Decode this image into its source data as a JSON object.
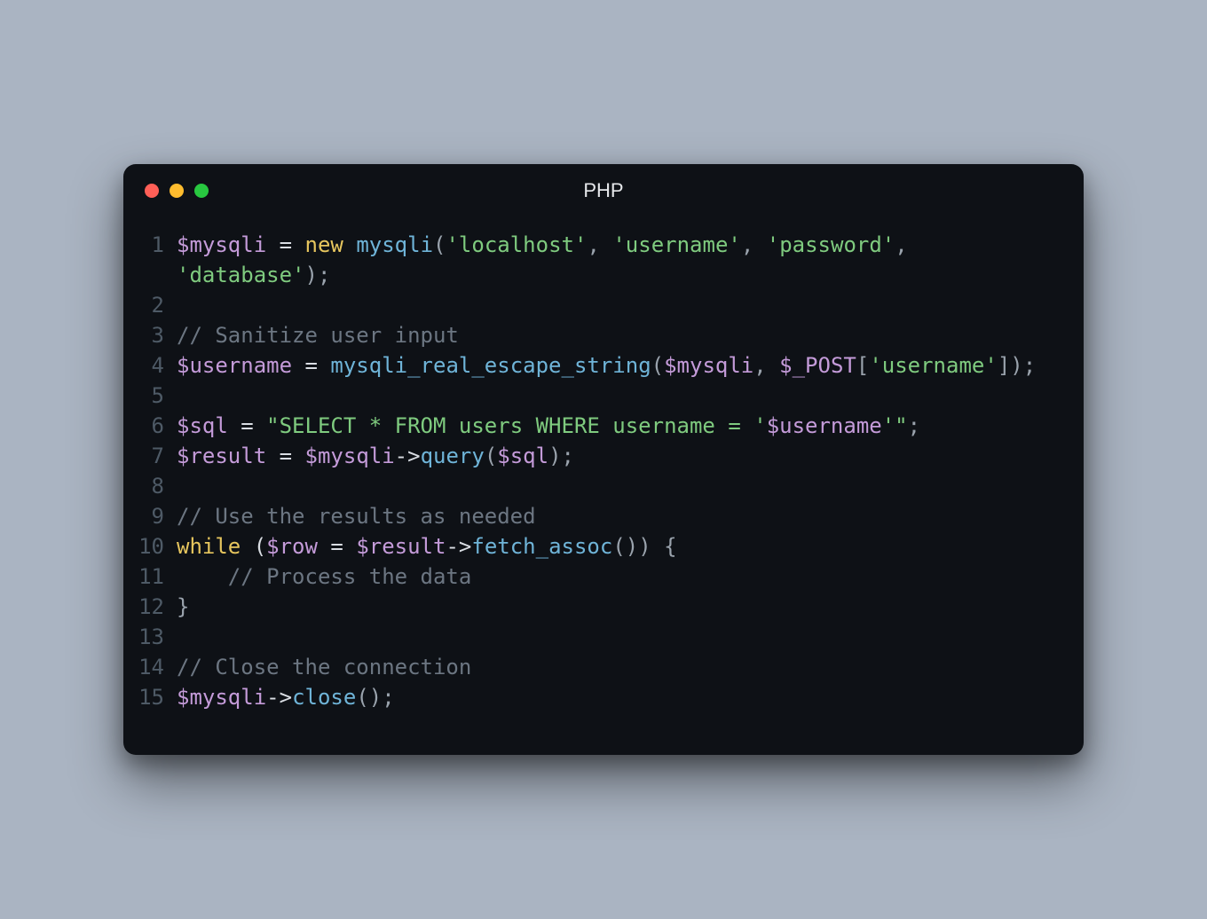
{
  "window": {
    "title": "PHP"
  },
  "colors": {
    "traffic_red": "#ff5f57",
    "traffic_yellow": "#febc2e",
    "traffic_green": "#28c840",
    "bg": "#0e1116",
    "page_bg": "#aab4c2"
  },
  "code": {
    "line_numbers": [
      "1",
      "2",
      "3",
      "4",
      "5",
      "6",
      "7",
      "8",
      "9",
      "10",
      "11",
      "12",
      "13",
      "14",
      "15"
    ],
    "lines": [
      {
        "n": "1",
        "tokens": [
          {
            "c": "tok-var",
            "t": "$mysqli"
          },
          {
            "c": "tok-op",
            "t": " = "
          },
          {
            "c": "tok-kw",
            "t": "new"
          },
          {
            "c": "tok-op",
            "t": " "
          },
          {
            "c": "tok-fn",
            "t": "mysqli"
          },
          {
            "c": "tok-punc",
            "t": "("
          },
          {
            "c": "tok-str",
            "t": "'localhost'"
          },
          {
            "c": "tok-punc",
            "t": ", "
          },
          {
            "c": "tok-str",
            "t": "'username'"
          },
          {
            "c": "tok-punc",
            "t": ", "
          },
          {
            "c": "tok-str",
            "t": "'password'"
          },
          {
            "c": "tok-punc",
            "t": ", "
          },
          {
            "c": "tok-str",
            "t": "'database'"
          },
          {
            "c": "tok-punc",
            "t": ");"
          }
        ]
      },
      {
        "n": "2",
        "tokens": []
      },
      {
        "n": "3",
        "tokens": [
          {
            "c": "tok-cmt",
            "t": "// Sanitize user input"
          }
        ]
      },
      {
        "n": "4",
        "tokens": [
          {
            "c": "tok-var",
            "t": "$username"
          },
          {
            "c": "tok-op",
            "t": " = "
          },
          {
            "c": "tok-fn",
            "t": "mysqli_real_escape_string"
          },
          {
            "c": "tok-punc",
            "t": "("
          },
          {
            "c": "tok-var",
            "t": "$mysqli"
          },
          {
            "c": "tok-punc",
            "t": ", "
          },
          {
            "c": "tok-var",
            "t": "$_POST"
          },
          {
            "c": "tok-punc",
            "t": "["
          },
          {
            "c": "tok-str",
            "t": "'username'"
          },
          {
            "c": "tok-punc",
            "t": "]);"
          }
        ]
      },
      {
        "n": "5",
        "tokens": []
      },
      {
        "n": "6",
        "tokens": [
          {
            "c": "tok-var",
            "t": "$sql"
          },
          {
            "c": "tok-op",
            "t": " = "
          },
          {
            "c": "tok-str",
            "t": "\"SELECT * FROM users WHERE username = '"
          },
          {
            "c": "tok-var",
            "t": "$username"
          },
          {
            "c": "tok-str",
            "t": "'\""
          },
          {
            "c": "tok-punc",
            "t": ";"
          }
        ]
      },
      {
        "n": "7",
        "tokens": [
          {
            "c": "tok-var",
            "t": "$result"
          },
          {
            "c": "tok-op",
            "t": " = "
          },
          {
            "c": "tok-var",
            "t": "$mysqli"
          },
          {
            "c": "tok-op",
            "t": "->"
          },
          {
            "c": "tok-fn",
            "t": "query"
          },
          {
            "c": "tok-punc",
            "t": "("
          },
          {
            "c": "tok-var",
            "t": "$sql"
          },
          {
            "c": "tok-punc",
            "t": ");"
          }
        ]
      },
      {
        "n": "8",
        "tokens": []
      },
      {
        "n": "9",
        "tokens": [
          {
            "c": "tok-cmt",
            "t": "// Use the results as needed"
          }
        ]
      },
      {
        "n": "10",
        "tokens": [
          {
            "c": "tok-kw",
            "t": "while"
          },
          {
            "c": "tok-op",
            "t": " ("
          },
          {
            "c": "tok-var",
            "t": "$row"
          },
          {
            "c": "tok-op",
            "t": " = "
          },
          {
            "c": "tok-var",
            "t": "$result"
          },
          {
            "c": "tok-op",
            "t": "->"
          },
          {
            "c": "tok-fn",
            "t": "fetch_assoc"
          },
          {
            "c": "tok-punc",
            "t": "()) {"
          }
        ]
      },
      {
        "n": "11",
        "tokens": [
          {
            "c": "tok-op",
            "t": "    "
          },
          {
            "c": "tok-cmt",
            "t": "// Process the data"
          }
        ]
      },
      {
        "n": "12",
        "tokens": [
          {
            "c": "tok-punc",
            "t": "}"
          }
        ]
      },
      {
        "n": "13",
        "tokens": []
      },
      {
        "n": "14",
        "tokens": [
          {
            "c": "tok-cmt",
            "t": "// Close the connection"
          }
        ]
      },
      {
        "n": "15",
        "tokens": [
          {
            "c": "tok-var",
            "t": "$mysqli"
          },
          {
            "c": "tok-op",
            "t": "->"
          },
          {
            "c": "tok-fn",
            "t": "close"
          },
          {
            "c": "tok-punc",
            "t": "();"
          }
        ]
      }
    ]
  }
}
